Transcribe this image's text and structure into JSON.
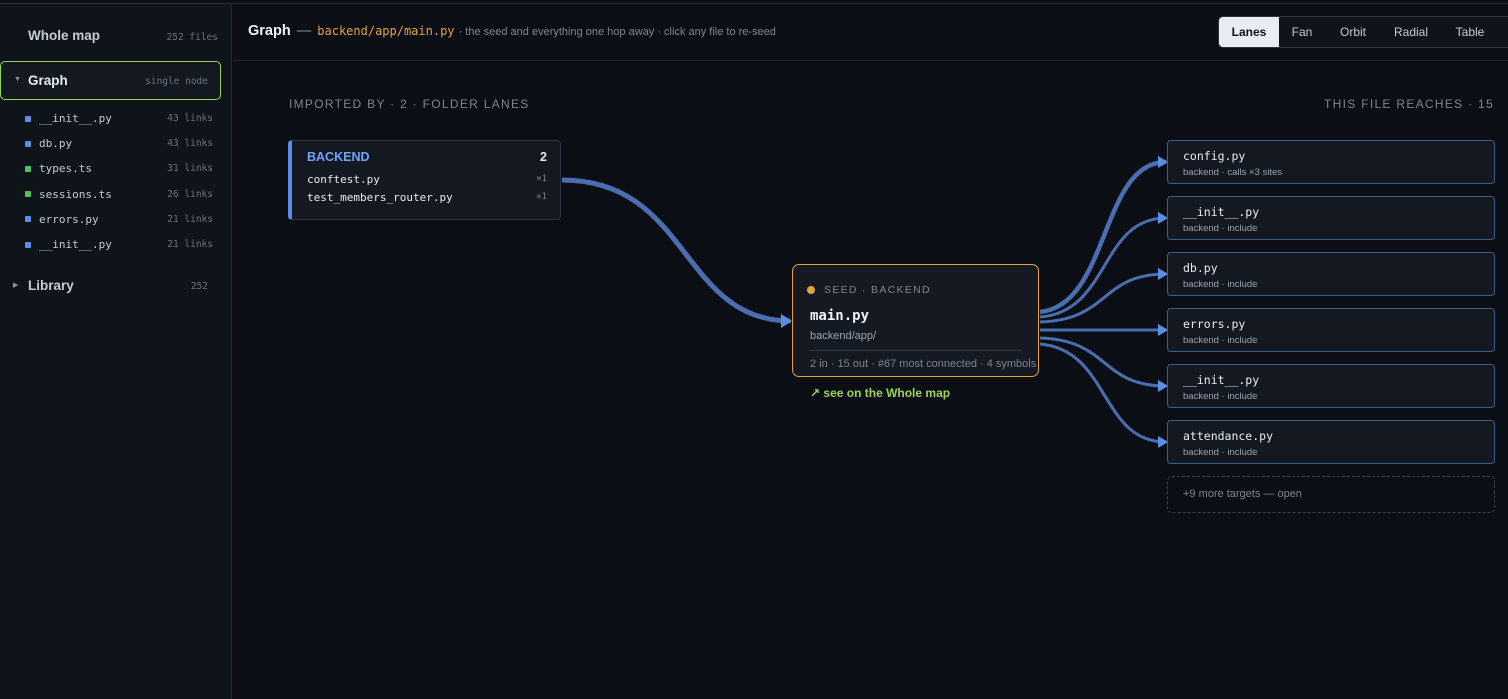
{
  "sidebar": {
    "whole_map": {
      "label": "Whole map",
      "count": "252 files"
    },
    "graph": {
      "label": "Graph",
      "meta": "single node"
    },
    "items": [
      {
        "name": "__init__.py",
        "links": "43 links",
        "color": "#5a8fe8"
      },
      {
        "name": "db.py",
        "links": "43 links",
        "color": "#5a8fe8"
      },
      {
        "name": "types.ts",
        "links": "31 links",
        "color": "#4cc464"
      },
      {
        "name": "sessions.ts",
        "links": "26 links",
        "color": "#4cc464"
      },
      {
        "name": "errors.py",
        "links": "21 links",
        "color": "#5a8fe8"
      },
      {
        "name": "__init__.py",
        "links": "21 links",
        "color": "#5a8fe8"
      }
    ],
    "library": {
      "label": "Library",
      "count": "252"
    }
  },
  "header": {
    "title": "Graph",
    "dash": "—",
    "path": "backend/app/main.py",
    "description": "· the seed and everything one hop away · click any file to re-seed"
  },
  "tabs": [
    {
      "label": "Lanes",
      "active": true
    },
    {
      "label": "Fan",
      "active": false
    },
    {
      "label": "Orbit",
      "active": false
    },
    {
      "label": "Radial",
      "active": false
    },
    {
      "label": "Table",
      "active": false
    }
  ],
  "lanes": {
    "imported_by": "IMPORTED BY · 2 · FOLDER LANES",
    "reaches": "THIS FILE REACHES · 15"
  },
  "importer_group": {
    "name": "BACKEND",
    "count": "2",
    "files": [
      {
        "name": "conftest.py",
        "mult": "×1"
      },
      {
        "name": "test_members_router.py",
        "mult": "×1"
      }
    ]
  },
  "seed": {
    "tag": "SEED · BACKEND",
    "name": "main.py",
    "path": "backend/app/",
    "stats": "2 in · 15 out · #67 most connected · 4 symbols",
    "color": "#e3a43a"
  },
  "whole_map_link": "↗ see on the Whole map",
  "targets": [
    {
      "name": "config.py",
      "detail": "backend · calls ×3 sites"
    },
    {
      "name": "__init__.py",
      "detail": "backend · include"
    },
    {
      "name": "db.py",
      "detail": "backend · include"
    },
    {
      "name": "errors.py",
      "detail": "backend · include"
    },
    {
      "name": "__init__.py",
      "detail": "backend · include"
    },
    {
      "name": "attendance.py",
      "detail": "backend · include"
    }
  ],
  "more_targets": "+9 more targets — open",
  "colors": {
    "edge": "#4a6fb0",
    "accent": "#9bd45a",
    "seed": "#e3a43a"
  }
}
